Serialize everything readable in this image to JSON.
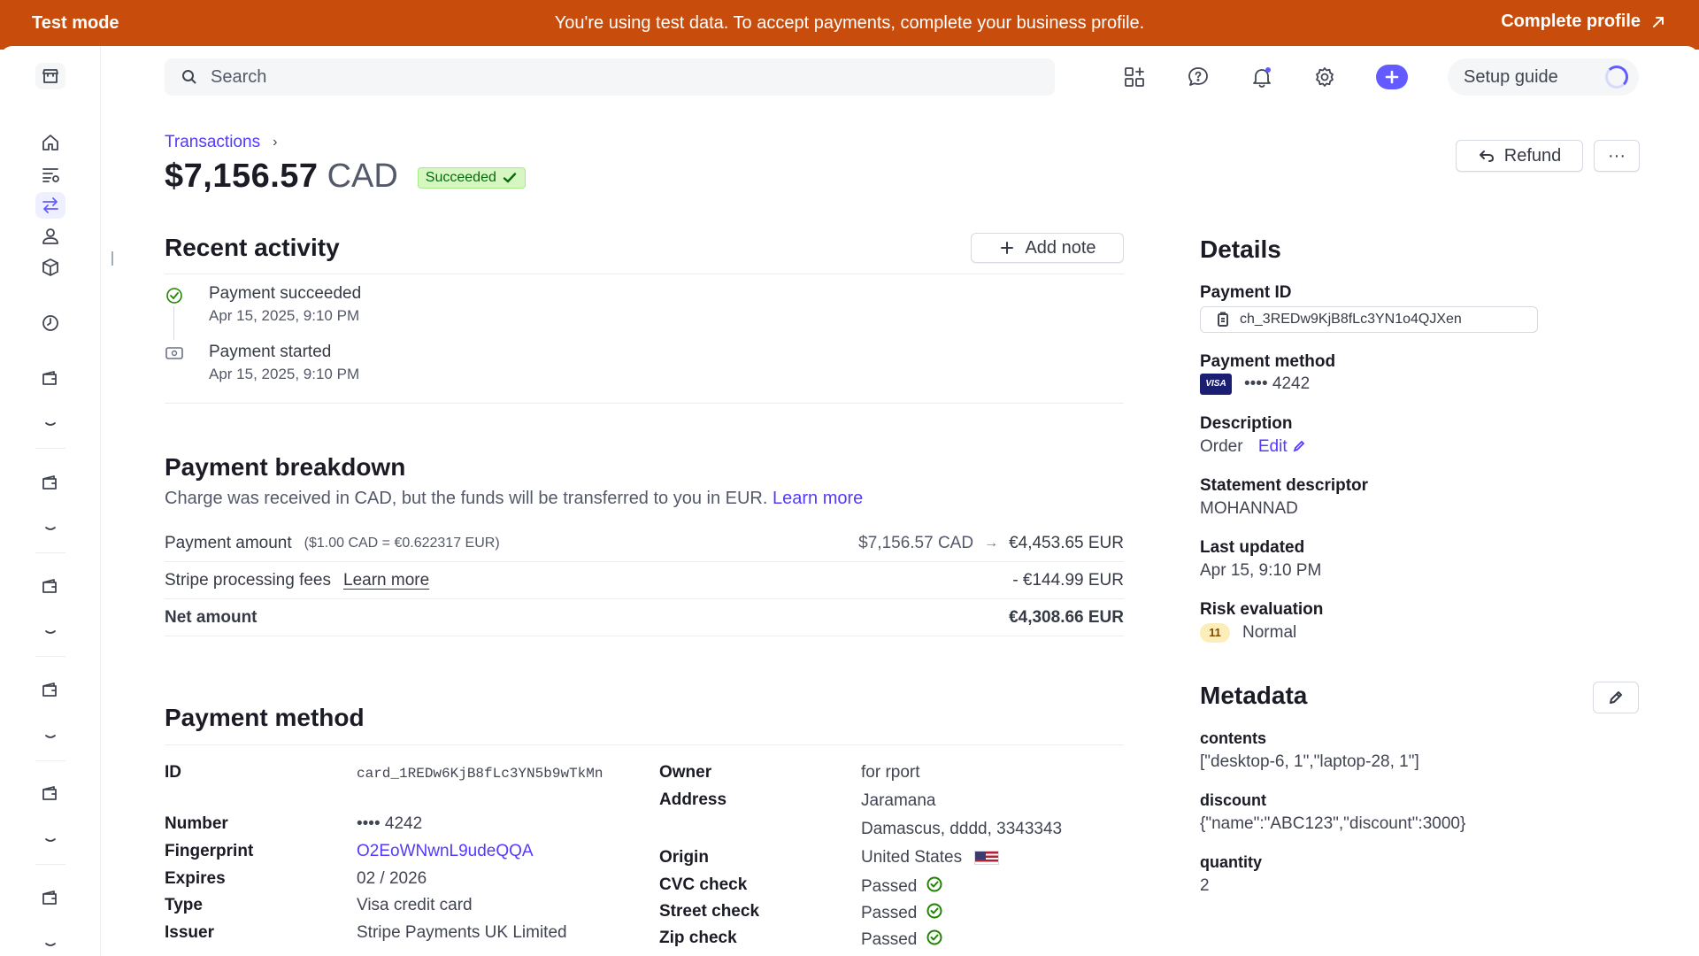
{
  "banner": {
    "mode_label": "Test mode",
    "message": "You're using test data. To accept payments, complete your business profile.",
    "cta_label": "Complete profile"
  },
  "search": {
    "placeholder": "Search"
  },
  "topbar": {
    "setup_guide_label": "Setup guide",
    "accent_color": "#635bff"
  },
  "sidebar": {
    "icons": [
      "store-icon",
      "home-icon",
      "balances-icon",
      "transactions-icon",
      "customers-icon",
      "products-icon",
      "clock-icon",
      "wallet-icon",
      "wallet-icon",
      "wallet-icon",
      "wallet-icon",
      "wallet-icon",
      "wallet-icon"
    ],
    "active": "transactions-icon"
  },
  "header": {
    "breadcrumb": "Transactions",
    "amount": "$7,156.57",
    "currency": "CAD",
    "status": "Succeeded",
    "refund_label": "Refund",
    "more_label": "···"
  },
  "recent_activity": {
    "title": "Recent activity",
    "add_note_label": "Add note",
    "items": [
      {
        "title": "Payment succeeded",
        "date": "Apr 15, 2025, 9:10 PM"
      },
      {
        "title": "Payment started",
        "date": "Apr 15, 2025, 9:10 PM"
      }
    ]
  },
  "payment_breakdown": {
    "title": "Payment breakdown",
    "note": "Charge was received in CAD, but the funds will be transferred to you in EUR.",
    "note_link": "Learn more",
    "rows": [
      {
        "label": "Payment amount",
        "rate": "($1.00 CAD = €0.622317 EUR)",
        "from": "$7,156.57 CAD",
        "to": "€4,453.65 EUR"
      },
      {
        "label": "Stripe processing fees",
        "link": "Learn more",
        "value": "- €144.99 EUR"
      },
      {
        "label": "Net amount",
        "value": "€4,308.66 EUR"
      }
    ]
  },
  "payment_method": {
    "title": "Payment method",
    "left": {
      "id_label": "ID",
      "id_value": "card_1REDw6KjB8fLc3YN5b9wTkMn",
      "number_label": "Number",
      "number_value": "•••• 4242",
      "fingerprint_label": "Fingerprint",
      "fingerprint_value": "O2EoWNwnL9udeQQA",
      "expires_label": "Expires",
      "expires_value": "02 / 2026",
      "type_label": "Type",
      "type_value": "Visa credit card",
      "issuer_label": "Issuer",
      "issuer_value": "Stripe Payments UK Limited"
    },
    "right": {
      "owner_label": "Owner",
      "owner_value": "for rport",
      "address_label": "Address",
      "address_line1": "Jaramana",
      "address_line2": "Damascus, dddd, 3343343",
      "origin_label": "Origin",
      "origin_value": "United States",
      "cvc_label": "CVC check",
      "cvc_value": "Passed",
      "street_label": "Street check",
      "street_value": "Passed",
      "zip_label": "Zip check",
      "zip_value": "Passed"
    }
  },
  "details": {
    "title": "Details",
    "payment_id_label": "Payment ID",
    "payment_id": "ch_3REDw9KjB8fLc3YN1o4QJXen",
    "payment_method_label": "Payment method",
    "card_brand": "VISA",
    "card_last4": "•••• 4242",
    "description_label": "Description",
    "description": "Order",
    "edit_label": "Edit",
    "statement_label": "Statement descriptor",
    "statement": "MOHANNAD",
    "updated_label": "Last updated",
    "updated": "Apr 15, 9:10 PM",
    "risk_label": "Risk evaluation",
    "risk_score": "11",
    "risk_level": "Normal"
  },
  "metadata": {
    "title": "Metadata",
    "items": [
      {
        "key": "contents",
        "value": "[\"desktop-6, 1\",\"laptop-28, 1\"]"
      },
      {
        "key": "discount",
        "value": "{\"name\":\"ABC123\",\"discount\":3000}"
      },
      {
        "key": "quantity",
        "value": "2"
      }
    ]
  }
}
